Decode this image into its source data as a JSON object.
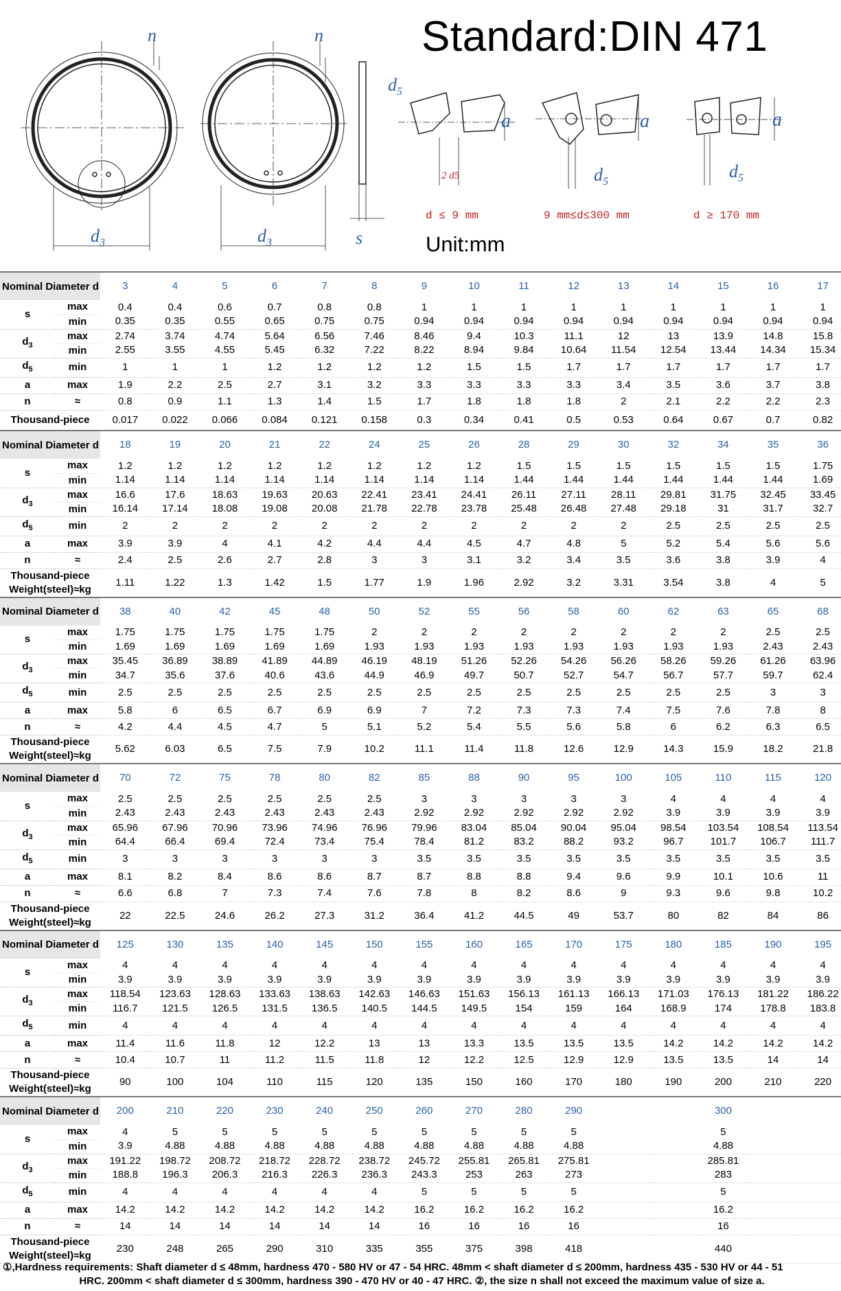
{
  "title": "Standard:DIN 471",
  "unit": "Unit:mm",
  "drawing_labels": {
    "n": "n",
    "d3": "d",
    "d3_sub": "3",
    "s": "s",
    "d5": "d",
    "d5_sub": "5",
    "a": "a",
    "two_d5": "2 d5",
    "case1": "d ≤ 9 mm",
    "case2": "9 mm≤d≤300 mm",
    "case3": "d ≥ 170 mm"
  },
  "row_labels": {
    "nominal": "Nominal Diameter d",
    "s": "s",
    "d3": "d",
    "d3_sub": "3",
    "d5": "d",
    "d5_sub": "5",
    "a": "a",
    "n": "n",
    "max": "max",
    "min": "min",
    "approx": "≈",
    "weight_short": "Thousand-piece",
    "weight_long_1": "Thousand-piece",
    "weight_long_2": "Weight(steel)≈kg"
  },
  "blocks": [
    {
      "d": [
        "3",
        "4",
        "5",
        "6",
        "7",
        "8",
        "9",
        "10",
        "11",
        "12",
        "13",
        "14",
        "15",
        "16",
        "17"
      ],
      "s_max": [
        "0.4",
        "0.4",
        "0.6",
        "0.7",
        "0.8",
        "0.8",
        "1",
        "1",
        "1",
        "1",
        "1",
        "1",
        "1",
        "1",
        "1"
      ],
      "s_min": [
        "0.35",
        "0.35",
        "0.55",
        "0.65",
        "0.75",
        "0.75",
        "0.94",
        "0.94",
        "0.94",
        "0.94",
        "0.94",
        "0.94",
        "0.94",
        "0.94",
        "0.94"
      ],
      "d3_max": [
        "2.74",
        "3.74",
        "4.74",
        "5.64",
        "6.56",
        "7.46",
        "8.46",
        "9.4",
        "10.3",
        "11.1",
        "12",
        "13",
        "13.9",
        "14.8",
        "15.8"
      ],
      "d3_min": [
        "2.55",
        "3.55",
        "4.55",
        "5.45",
        "6.32",
        "7.22",
        "8.22",
        "8.94",
        "9.84",
        "10.64",
        "11.54",
        "12.54",
        "13.44",
        "14.34",
        "15.34"
      ],
      "d5": [
        "1",
        "1",
        "1",
        "1.2",
        "1.2",
        "1.2",
        "1.2",
        "1.5",
        "1.5",
        "1.7",
        "1.7",
        "1.7",
        "1.7",
        "1.7",
        "1.7"
      ],
      "a": [
        "1.9",
        "2.2",
        "2.5",
        "2.7",
        "3.1",
        "3.2",
        "3.3",
        "3.3",
        "3.3",
        "3.3",
        "3.4",
        "3.5",
        "3.6",
        "3.7",
        "3.8"
      ],
      "n": [
        "0.8",
        "0.9",
        "1.1",
        "1.3",
        "1.4",
        "1.5",
        "1.7",
        "1.8",
        "1.8",
        "1.8",
        "2",
        "2.1",
        "2.2",
        "2.2",
        "2.3"
      ],
      "w": [
        "0.017",
        "0.022",
        "0.066",
        "0.084",
        "0.121",
        "0.158",
        "0.3",
        "0.34",
        "0.41",
        "0.5",
        "0.53",
        "0.64",
        "0.67",
        "0.7",
        "0.82"
      ]
    },
    {
      "d": [
        "18",
        "19",
        "20",
        "21",
        "22",
        "24",
        "25",
        "26",
        "28",
        "29",
        "30",
        "32",
        "34",
        "35",
        "36"
      ],
      "s_max": [
        "1.2",
        "1.2",
        "1.2",
        "1.2",
        "1.2",
        "1.2",
        "1.2",
        "1.2",
        "1.5",
        "1.5",
        "1.5",
        "1.5",
        "1.5",
        "1.5",
        "1.75"
      ],
      "s_min": [
        "1.14",
        "1.14",
        "1.14",
        "1.14",
        "1.14",
        "1.14",
        "1.14",
        "1.14",
        "1.44",
        "1.44",
        "1.44",
        "1.44",
        "1.44",
        "1.44",
        "1.69"
      ],
      "d3_max": [
        "16.6",
        "17.6",
        "18.63",
        "19.63",
        "20.63",
        "22.41",
        "23.41",
        "24.41",
        "26.11",
        "27.11",
        "28.11",
        "29.81",
        "31.75",
        "32.45",
        "33.45"
      ],
      "d3_min": [
        "16.14",
        "17.14",
        "18.08",
        "19.08",
        "20.08",
        "21.78",
        "22.78",
        "23.78",
        "25.48",
        "26.48",
        "27.48",
        "29.18",
        "31",
        "31.7",
        "32.7"
      ],
      "d5": [
        "2",
        "2",
        "2",
        "2",
        "2",
        "2",
        "2",
        "2",
        "2",
        "2",
        "2",
        "2.5",
        "2.5",
        "2.5",
        "2.5"
      ],
      "a": [
        "3.9",
        "3.9",
        "4",
        "4.1",
        "4.2",
        "4.4",
        "4.4",
        "4.5",
        "4.7",
        "4.8",
        "5",
        "5.2",
        "5.4",
        "5.6",
        "5.6"
      ],
      "n": [
        "2.4",
        "2.5",
        "2.6",
        "2.7",
        "2.8",
        "3",
        "3",
        "3.1",
        "3.2",
        "3.4",
        "3.5",
        "3.6",
        "3.8",
        "3.9",
        "4"
      ],
      "w": [
        "1.11",
        "1.22",
        "1.3",
        "1.42",
        "1.5",
        "1.77",
        "1.9",
        "1.96",
        "2.92",
        "3.2",
        "3.31",
        "3.54",
        "3.8",
        "4",
        "5"
      ]
    },
    {
      "d": [
        "38",
        "40",
        "42",
        "45",
        "48",
        "50",
        "52",
        "55",
        "56",
        "58",
        "60",
        "62",
        "63",
        "65",
        "68"
      ],
      "s_max": [
        "1.75",
        "1.75",
        "1.75",
        "1.75",
        "1.75",
        "2",
        "2",
        "2",
        "2",
        "2",
        "2",
        "2",
        "2",
        "2.5",
        "2.5"
      ],
      "s_min": [
        "1.69",
        "1.69",
        "1.69",
        "1.69",
        "1.69",
        "1.93",
        "1.93",
        "1.93",
        "1.93",
        "1.93",
        "1.93",
        "1.93",
        "1.93",
        "2.43",
        "2.43"
      ],
      "d3_max": [
        "35.45",
        "36.89",
        "38.89",
        "41.89",
        "44.89",
        "46.19",
        "48.19",
        "51.26",
        "52.26",
        "54.26",
        "56.26",
        "58.26",
        "59.26",
        "61.26",
        "63.96"
      ],
      "d3_min": [
        "34.7",
        "35.6",
        "37.6",
        "40.6",
        "43.6",
        "44.9",
        "46.9",
        "49.7",
        "50.7",
        "52.7",
        "54.7",
        "56.7",
        "57.7",
        "59.7",
        "62.4"
      ],
      "d5": [
        "2.5",
        "2.5",
        "2.5",
        "2.5",
        "2.5",
        "2.5",
        "2.5",
        "2.5",
        "2.5",
        "2.5",
        "2.5",
        "2.5",
        "2.5",
        "3",
        "3"
      ],
      "a": [
        "5.8",
        "6",
        "6.5",
        "6.7",
        "6.9",
        "6.9",
        "7",
        "7.2",
        "7.3",
        "7.3",
        "7.4",
        "7.5",
        "7.6",
        "7.8",
        "8"
      ],
      "n": [
        "4.2",
        "4.4",
        "4.5",
        "4.7",
        "5",
        "5.1",
        "5.2",
        "5.4",
        "5.5",
        "5.6",
        "5.8",
        "6",
        "6.2",
        "6.3",
        "6.5"
      ],
      "w": [
        "5.62",
        "6.03",
        "6.5",
        "7.5",
        "7.9",
        "10.2",
        "11.1",
        "11.4",
        "11.8",
        "12.6",
        "12.9",
        "14.3",
        "15.9",
        "18.2",
        "21.8"
      ]
    },
    {
      "d": [
        "70",
        "72",
        "75",
        "78",
        "80",
        "82",
        "85",
        "88",
        "90",
        "95",
        "100",
        "105",
        "110",
        "115",
        "120"
      ],
      "s_max": [
        "2.5",
        "2.5",
        "2.5",
        "2.5",
        "2.5",
        "2.5",
        "3",
        "3",
        "3",
        "3",
        "3",
        "4",
        "4",
        "4",
        "4"
      ],
      "s_min": [
        "2.43",
        "2.43",
        "2.43",
        "2.43",
        "2.43",
        "2.43",
        "2.92",
        "2.92",
        "2.92",
        "2.92",
        "2.92",
        "3.9",
        "3.9",
        "3.9",
        "3.9"
      ],
      "d3_max": [
        "65.96",
        "67.96",
        "70.96",
        "73.96",
        "74.96",
        "76.96",
        "79.96",
        "83.04",
        "85.04",
        "90.04",
        "95.04",
        "98.54",
        "103.54",
        "108.54",
        "113.54"
      ],
      "d3_min": [
        "64.4",
        "66.4",
        "69.4",
        "72.4",
        "73.4",
        "75.4",
        "78.4",
        "81.2",
        "83.2",
        "88.2",
        "93.2",
        "96.7",
        "101.7",
        "106.7",
        "111.7"
      ],
      "d5": [
        "3",
        "3",
        "3",
        "3",
        "3",
        "3",
        "3.5",
        "3.5",
        "3.5",
        "3.5",
        "3.5",
        "3.5",
        "3.5",
        "3.5",
        "3.5"
      ],
      "a": [
        "8.1",
        "8.2",
        "8.4",
        "8.6",
        "8.6",
        "8.7",
        "8.7",
        "8.8",
        "8.8",
        "9.4",
        "9.6",
        "9.9",
        "10.1",
        "10.6",
        "11"
      ],
      "n": [
        "6.6",
        "6.8",
        "7",
        "7.3",
        "7.4",
        "7.6",
        "7.8",
        "8",
        "8.2",
        "8.6",
        "9",
        "9.3",
        "9.6",
        "9.8",
        "10.2"
      ],
      "w": [
        "22",
        "22.5",
        "24.6",
        "26.2",
        "27.3",
        "31.2",
        "36.4",
        "41.2",
        "44.5",
        "49",
        "53.7",
        "80",
        "82",
        "84",
        "86"
      ]
    },
    {
      "d": [
        "125",
        "130",
        "135",
        "140",
        "145",
        "150",
        "155",
        "160",
        "165",
        "170",
        "175",
        "180",
        "185",
        "190",
        "195"
      ],
      "s_max": [
        "4",
        "4",
        "4",
        "4",
        "4",
        "4",
        "4",
        "4",
        "4",
        "4",
        "4",
        "4",
        "4",
        "4",
        "4"
      ],
      "s_min": [
        "3.9",
        "3.9",
        "3.9",
        "3.9",
        "3.9",
        "3.9",
        "3.9",
        "3.9",
        "3.9",
        "3.9",
        "3.9",
        "3.9",
        "3.9",
        "3.9",
        "3.9"
      ],
      "d3_max": [
        "118.54",
        "123.63",
        "128.63",
        "133.63",
        "138.63",
        "142.63",
        "146.63",
        "151.63",
        "156.13",
        "161.13",
        "166.13",
        "171.03",
        "176.13",
        "181.22",
        "186.22"
      ],
      "d3_min": [
        "116.7",
        "121.5",
        "126.5",
        "131.5",
        "136.5",
        "140.5",
        "144.5",
        "149.5",
        "154",
        "159",
        "164",
        "168.9",
        "174",
        "178.8",
        "183.8"
      ],
      "d5": [
        "4",
        "4",
        "4",
        "4",
        "4",
        "4",
        "4",
        "4",
        "4",
        "4",
        "4",
        "4",
        "4",
        "4",
        "4"
      ],
      "a": [
        "11.4",
        "11.6",
        "11.8",
        "12",
        "12.2",
        "13",
        "13",
        "13.3",
        "13.5",
        "13.5",
        "13.5",
        "14.2",
        "14.2",
        "14.2",
        "14.2"
      ],
      "n": [
        "10.4",
        "10.7",
        "11",
        "11.2",
        "11.5",
        "11.8",
        "12",
        "12.2",
        "12.5",
        "12.9",
        "12.9",
        "13.5",
        "13.5",
        "14",
        "14"
      ],
      "w": [
        "90",
        "100",
        "104",
        "110",
        "115",
        "120",
        "135",
        "150",
        "160",
        "170",
        "180",
        "190",
        "200",
        "210",
        "220"
      ]
    },
    {
      "d": [
        "200",
        "210",
        "220",
        "230",
        "240",
        "250",
        "260",
        "270",
        "280",
        "290",
        "300"
      ],
      "s_max": [
        "4",
        "5",
        "5",
        "5",
        "5",
        "5",
        "5",
        "5",
        "5",
        "5",
        "5"
      ],
      "s_min": [
        "3.9",
        "4.88",
        "4.88",
        "4.88",
        "4.88",
        "4.88",
        "4.88",
        "4.88",
        "4.88",
        "4.88",
        "4.88"
      ],
      "d3_max": [
        "191.22",
        "198.72",
        "208.72",
        "218.72",
        "228.72",
        "238.72",
        "245.72",
        "255.81",
        "265.81",
        "275.81",
        "285.81"
      ],
      "d3_min": [
        "188.8",
        "196.3",
        "206.3",
        "216.3",
        "226.3",
        "236.3",
        "243.3",
        "253",
        "263",
        "273",
        "283"
      ],
      "d5": [
        "4",
        "4",
        "4",
        "4",
        "4",
        "4",
        "5",
        "5",
        "5",
        "5",
        "5"
      ],
      "a": [
        "14.2",
        "14.2",
        "14.2",
        "14.2",
        "14.2",
        "14.2",
        "16.2",
        "16.2",
        "16.2",
        "16.2",
        "16.2"
      ],
      "n": [
        "14",
        "14",
        "14",
        "14",
        "14",
        "14",
        "16",
        "16",
        "16",
        "16",
        "16"
      ],
      "w": [
        "230",
        "248",
        "265",
        "290",
        "310",
        "335",
        "355",
        "375",
        "398",
        "418",
        "440"
      ]
    }
  ],
  "footnote": {
    "line1": "①,Hardness requirements:  Shaft diameter d ≤ 48mm, hardness 470 - 580 HV or 47 - 54 HRC. 48mm < shaft diameter d ≤ 200mm, hardness 435 - 530 HV or 44 - 51",
    "line2": "HRC. 200mm < shaft diameter d ≤ 300mm, hardness 390 - 470 HV or 40 - 47 HRC. ②, the size n shall not exceed the maximum value of size a."
  }
}
